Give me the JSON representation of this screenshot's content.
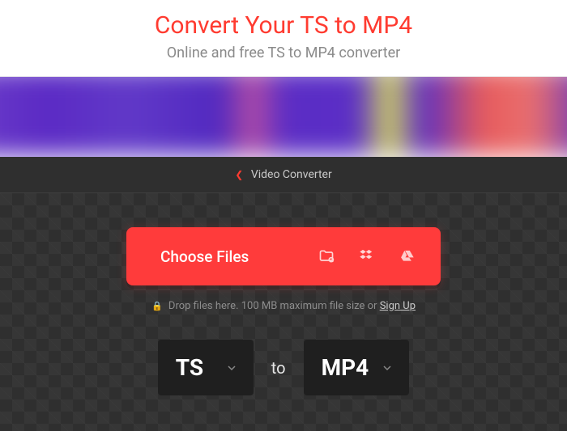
{
  "header": {
    "title": "Convert Your TS to MP4",
    "subtitle": "Online and free TS to MP4 converter"
  },
  "breadcrumb": {
    "label": "Video Converter"
  },
  "upload": {
    "button_label": "Choose Files",
    "hint_prefix": "Drop files here. 100 MB maximum file size or ",
    "signup_label": "Sign Up"
  },
  "formats": {
    "source": "TS",
    "separator": "to",
    "target": "MP4"
  }
}
